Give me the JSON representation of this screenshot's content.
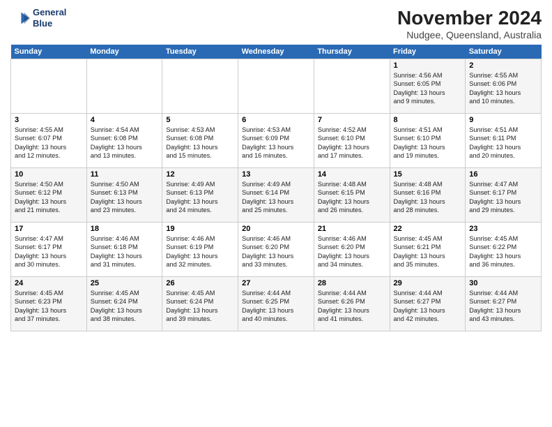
{
  "header": {
    "logo_line1": "General",
    "logo_line2": "Blue",
    "title": "November 2024",
    "subtitle": "Nudgee, Queensland, Australia"
  },
  "days_header": [
    "Sunday",
    "Monday",
    "Tuesday",
    "Wednesday",
    "Thursday",
    "Friday",
    "Saturday"
  ],
  "weeks": [
    [
      {
        "day": "",
        "detail": ""
      },
      {
        "day": "",
        "detail": ""
      },
      {
        "day": "",
        "detail": ""
      },
      {
        "day": "",
        "detail": ""
      },
      {
        "day": "",
        "detail": ""
      },
      {
        "day": "1",
        "detail": "Sunrise: 4:56 AM\nSunset: 6:05 PM\nDaylight: 13 hours\nand 9 minutes."
      },
      {
        "day": "2",
        "detail": "Sunrise: 4:55 AM\nSunset: 6:06 PM\nDaylight: 13 hours\nand 10 minutes."
      }
    ],
    [
      {
        "day": "3",
        "detail": "Sunrise: 4:55 AM\nSunset: 6:07 PM\nDaylight: 13 hours\nand 12 minutes."
      },
      {
        "day": "4",
        "detail": "Sunrise: 4:54 AM\nSunset: 6:08 PM\nDaylight: 13 hours\nand 13 minutes."
      },
      {
        "day": "5",
        "detail": "Sunrise: 4:53 AM\nSunset: 6:08 PM\nDaylight: 13 hours\nand 15 minutes."
      },
      {
        "day": "6",
        "detail": "Sunrise: 4:53 AM\nSunset: 6:09 PM\nDaylight: 13 hours\nand 16 minutes."
      },
      {
        "day": "7",
        "detail": "Sunrise: 4:52 AM\nSunset: 6:10 PM\nDaylight: 13 hours\nand 17 minutes."
      },
      {
        "day": "8",
        "detail": "Sunrise: 4:51 AM\nSunset: 6:10 PM\nDaylight: 13 hours\nand 19 minutes."
      },
      {
        "day": "9",
        "detail": "Sunrise: 4:51 AM\nSunset: 6:11 PM\nDaylight: 13 hours\nand 20 minutes."
      }
    ],
    [
      {
        "day": "10",
        "detail": "Sunrise: 4:50 AM\nSunset: 6:12 PM\nDaylight: 13 hours\nand 21 minutes."
      },
      {
        "day": "11",
        "detail": "Sunrise: 4:50 AM\nSunset: 6:13 PM\nDaylight: 13 hours\nand 23 minutes."
      },
      {
        "day": "12",
        "detail": "Sunrise: 4:49 AM\nSunset: 6:13 PM\nDaylight: 13 hours\nand 24 minutes."
      },
      {
        "day": "13",
        "detail": "Sunrise: 4:49 AM\nSunset: 6:14 PM\nDaylight: 13 hours\nand 25 minutes."
      },
      {
        "day": "14",
        "detail": "Sunrise: 4:48 AM\nSunset: 6:15 PM\nDaylight: 13 hours\nand 26 minutes."
      },
      {
        "day": "15",
        "detail": "Sunrise: 4:48 AM\nSunset: 6:16 PM\nDaylight: 13 hours\nand 28 minutes."
      },
      {
        "day": "16",
        "detail": "Sunrise: 4:47 AM\nSunset: 6:17 PM\nDaylight: 13 hours\nand 29 minutes."
      }
    ],
    [
      {
        "day": "17",
        "detail": "Sunrise: 4:47 AM\nSunset: 6:17 PM\nDaylight: 13 hours\nand 30 minutes."
      },
      {
        "day": "18",
        "detail": "Sunrise: 4:46 AM\nSunset: 6:18 PM\nDaylight: 13 hours\nand 31 minutes."
      },
      {
        "day": "19",
        "detail": "Sunrise: 4:46 AM\nSunset: 6:19 PM\nDaylight: 13 hours\nand 32 minutes."
      },
      {
        "day": "20",
        "detail": "Sunrise: 4:46 AM\nSunset: 6:20 PM\nDaylight: 13 hours\nand 33 minutes."
      },
      {
        "day": "21",
        "detail": "Sunrise: 4:46 AM\nSunset: 6:20 PM\nDaylight: 13 hours\nand 34 minutes."
      },
      {
        "day": "22",
        "detail": "Sunrise: 4:45 AM\nSunset: 6:21 PM\nDaylight: 13 hours\nand 35 minutes."
      },
      {
        "day": "23",
        "detail": "Sunrise: 4:45 AM\nSunset: 6:22 PM\nDaylight: 13 hours\nand 36 minutes."
      }
    ],
    [
      {
        "day": "24",
        "detail": "Sunrise: 4:45 AM\nSunset: 6:23 PM\nDaylight: 13 hours\nand 37 minutes."
      },
      {
        "day": "25",
        "detail": "Sunrise: 4:45 AM\nSunset: 6:24 PM\nDaylight: 13 hours\nand 38 minutes."
      },
      {
        "day": "26",
        "detail": "Sunrise: 4:45 AM\nSunset: 6:24 PM\nDaylight: 13 hours\nand 39 minutes."
      },
      {
        "day": "27",
        "detail": "Sunrise: 4:44 AM\nSunset: 6:25 PM\nDaylight: 13 hours\nand 40 minutes."
      },
      {
        "day": "28",
        "detail": "Sunrise: 4:44 AM\nSunset: 6:26 PM\nDaylight: 13 hours\nand 41 minutes."
      },
      {
        "day": "29",
        "detail": "Sunrise: 4:44 AM\nSunset: 6:27 PM\nDaylight: 13 hours\nand 42 minutes."
      },
      {
        "day": "30",
        "detail": "Sunrise: 4:44 AM\nSunset: 6:27 PM\nDaylight: 13 hours\nand 43 minutes."
      }
    ]
  ]
}
